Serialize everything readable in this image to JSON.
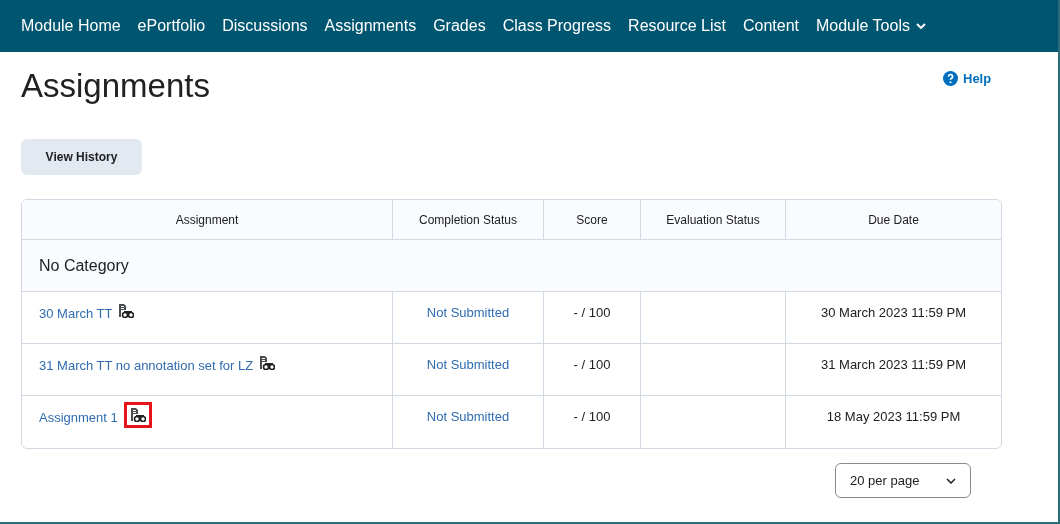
{
  "nav": {
    "items": [
      {
        "label": "Module Home"
      },
      {
        "label": "ePortfolio"
      },
      {
        "label": "Discussions"
      },
      {
        "label": "Assignments"
      },
      {
        "label": "Grades"
      },
      {
        "label": "Class Progress"
      },
      {
        "label": "Resource List"
      },
      {
        "label": "Content"
      },
      {
        "label": "Module Tools",
        "dropdown": true
      }
    ]
  },
  "page_title": "Assignments",
  "help": "Help",
  "view_history_button": "View History",
  "table": {
    "columns": [
      "Assignment",
      "Completion Status",
      "Score",
      "Evaluation Status",
      "Due Date"
    ],
    "category": "No Category",
    "rows": [
      {
        "name": "30 March TT",
        "status": "Not Submitted",
        "score": "- / 100",
        "due": "30 March 2023 11:59 PM",
        "highlighted": false
      },
      {
        "name": "31 March TT no annotation set for LZ",
        "status": "Not Submitted",
        "score": "- / 100",
        "due": "31 March 2023 11:59 PM",
        "highlighted": false
      },
      {
        "name": "Assignment 1",
        "status": "Not Submitted",
        "score": "- / 100",
        "due": "18 May 2023 11:59 PM",
        "highlighted": true
      }
    ]
  },
  "per_page": "20 per page"
}
